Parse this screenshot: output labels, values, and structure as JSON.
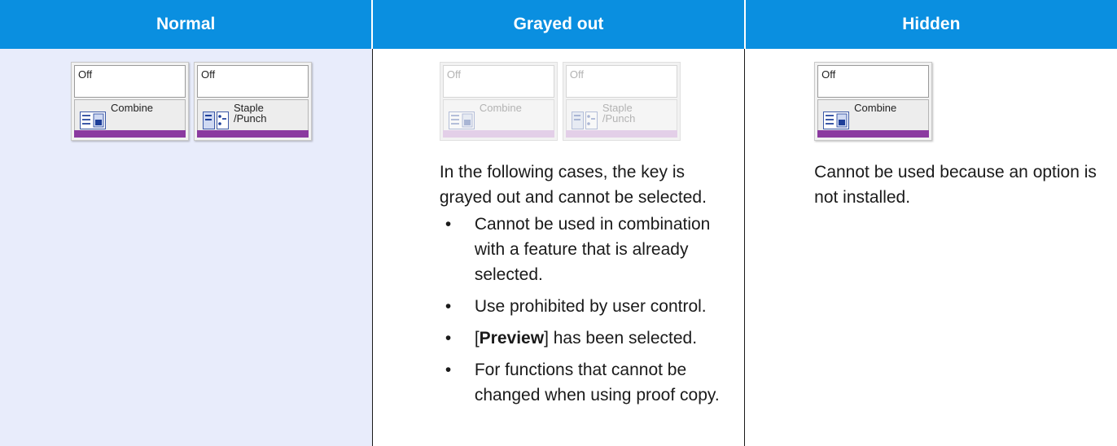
{
  "headers": {
    "normal": "Normal",
    "grayed_out": "Grayed out",
    "hidden": "Hidden"
  },
  "keys": {
    "off": "Off",
    "combine": "Combine",
    "staple_punch": "Staple\n/Punch"
  },
  "grayed_out": {
    "intro": "In the following cases, the key is grayed out and cannot be selected.",
    "bullets": [
      "Cannot be used in combination with a feature that is already selected.",
      "Use prohibited by user control.",
      "For functions that cannot be changed when using proof copy."
    ],
    "preview_bracket_open": "[",
    "preview_word": "Preview",
    "preview_rest": "] has been selected."
  },
  "hidden": {
    "text": "Cannot be used because an option is not installed."
  },
  "colors": {
    "header_bg": "#0a8fe0",
    "normal_col_bg": "#e8ecfb",
    "key_bar": "#8b3aa0"
  },
  "icons": {
    "combine": "combine-icon",
    "staple_punch": "staple-punch-icon"
  }
}
